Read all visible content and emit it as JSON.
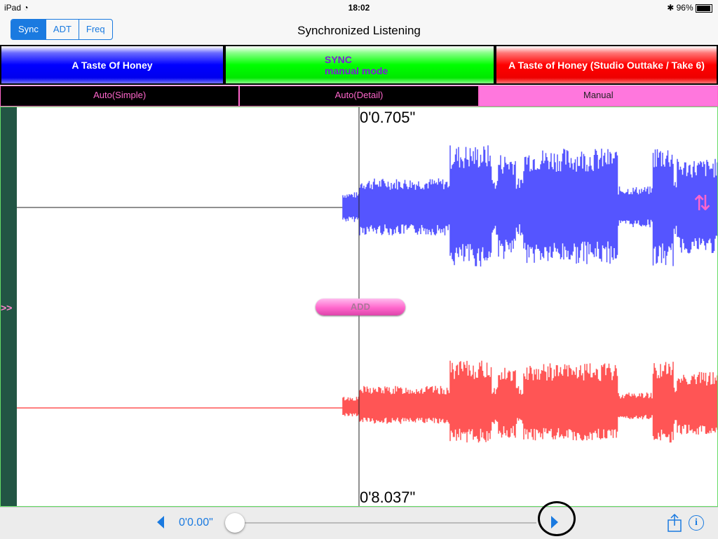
{
  "status": {
    "device": "iPad",
    "time": "18:02",
    "battery": "96%"
  },
  "nav": {
    "segments": [
      "Sync",
      "ADT",
      "Freq"
    ],
    "selected": "Sync",
    "title": "Synchronized Listening"
  },
  "tracks": {
    "left": "A Taste Of Honey",
    "center_line1": "SYNC",
    "center_line2": "manual mode",
    "right": "A Taste of Honey (Studio Outtake / Take 6)"
  },
  "modes": {
    "items": [
      "Auto(Simple)",
      "Auto(Detail)",
      "Manual"
    ],
    "selected": "Manual"
  },
  "waveform": {
    "top_time": "0'0.705\"",
    "bottom_time": "0'8.037\"",
    "add_label": "ADD",
    "expand_label": ">>",
    "colors": {
      "track1": "#5555ff",
      "track2": "#ff5555",
      "accent": "#ff66cc"
    }
  },
  "toolbar": {
    "position": "0'0.00\"",
    "slider_fraction": 0.0
  }
}
